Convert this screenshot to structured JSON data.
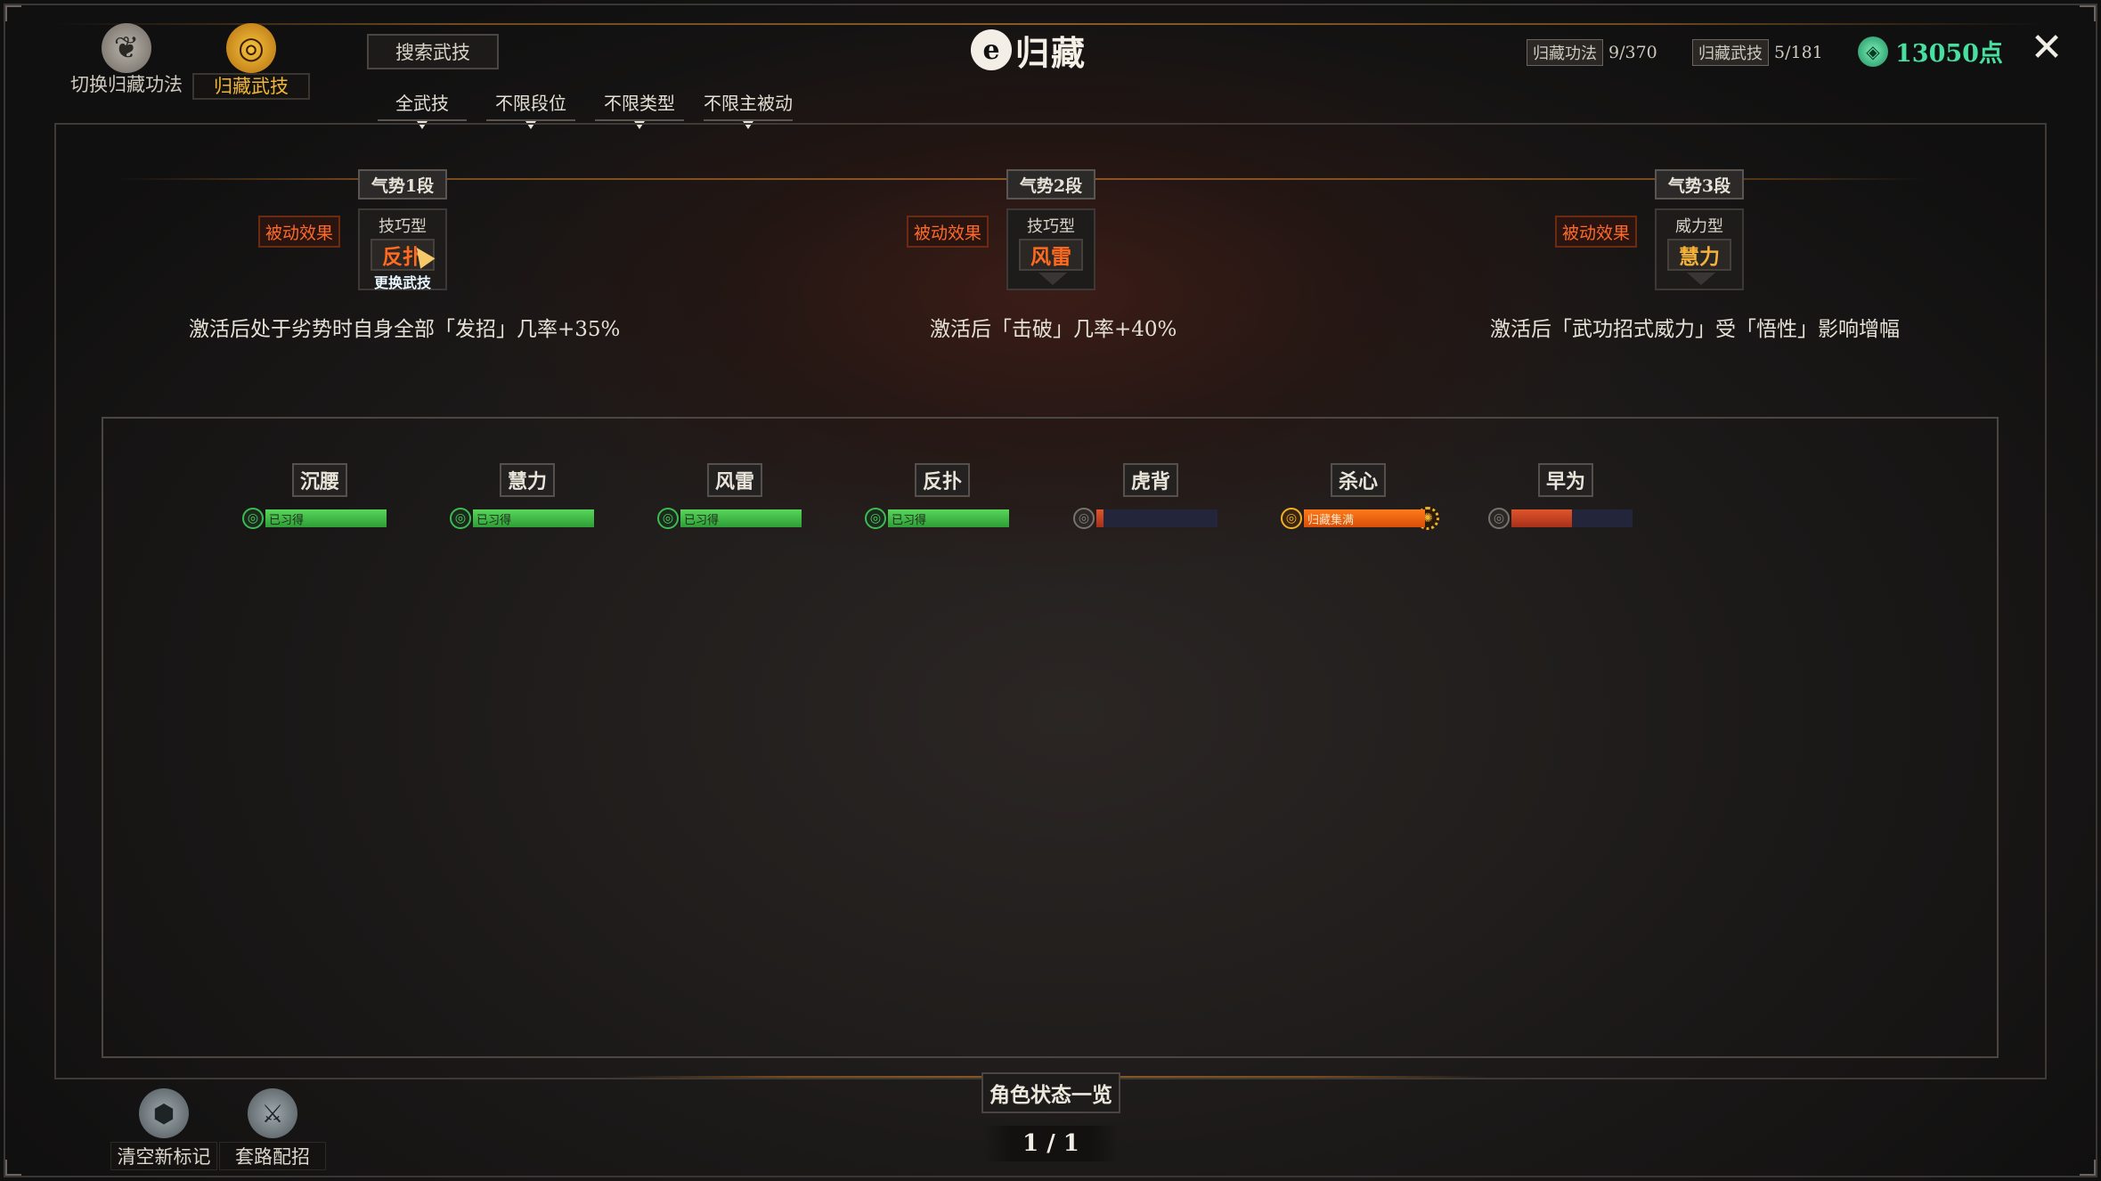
{
  "header": {
    "mode_buttons": [
      {
        "label": "切换归藏功法",
        "icon": "scroll-icon"
      },
      {
        "label": "归藏武技",
        "icon": "swirl-icon"
      }
    ],
    "search_label": "搜索武技",
    "filters": [
      "全武技",
      "不限段位",
      "不限类型",
      "不限主被动"
    ],
    "title_logo": "e",
    "title": "归藏",
    "stats": [
      {
        "tag": "归藏功法",
        "value": "9/370"
      },
      {
        "tag": "归藏武技",
        "value": "5/181"
      }
    ],
    "points": "13050点",
    "close_label": "✕"
  },
  "tiers": [
    {
      "head": "气势1段",
      "badge": "被动效果",
      "type": "技巧型",
      "skill": "反扑",
      "swap": "更换武技",
      "desc": "激活后处于劣势时自身全部「发招」几率+35%"
    },
    {
      "head": "气势2段",
      "badge": "被动效果",
      "type": "技巧型",
      "skill": "风雷",
      "desc": "激活后「击破」几率+40%"
    },
    {
      "head": "气势3段",
      "badge": "被动效果",
      "type": "威力型",
      "skill": "慧力",
      "desc": "激活后「武功招式威力」受「悟性」影响增幅"
    }
  ],
  "skills": [
    {
      "name": "沉腰",
      "status": "已习得",
      "progress": 1.0
    },
    {
      "name": "慧力",
      "status": "已习得",
      "progress": 1.0
    },
    {
      "name": "风雷",
      "status": "已习得",
      "progress": 1.0
    },
    {
      "name": "反扑",
      "status": "已习得",
      "progress": 1.0
    },
    {
      "name": "虎背",
      "status": "",
      "progress": 0.06
    },
    {
      "name": "杀心",
      "status": "归藏集满",
      "progress": 1.0
    },
    {
      "name": "早为",
      "status": "",
      "progress": 0.5
    }
  ],
  "footer": {
    "buttons": [
      {
        "label": "清空新标记",
        "icon": "hexagon-icon"
      },
      {
        "label": "套路配招",
        "icon": "crossed-swords-icon"
      }
    ],
    "status_label": "角色状态一览",
    "page": "1 / 1"
  },
  "colors": {
    "accent_orange": "#ff6a1e",
    "points_green": "#47e0a0",
    "learned_green": "#3dbb52",
    "gold": "#f0b02c"
  }
}
